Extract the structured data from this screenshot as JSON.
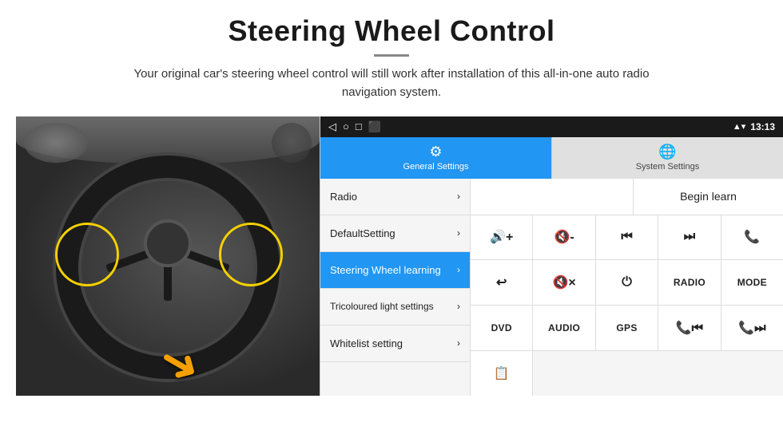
{
  "page": {
    "title": "Steering Wheel Control",
    "divider": "—",
    "subtitle": "Your original car's steering wheel control will still work after installation of this all-in-one auto radio navigation system."
  },
  "status_bar": {
    "time": "13:13",
    "back_icon": "◁",
    "home_icon": "○",
    "recent_icon": "□",
    "screenshot_icon": "⬛",
    "signal_icon": "▲",
    "wifi_icon": "▾"
  },
  "tabs": [
    {
      "id": "general",
      "label": "General Settings",
      "icon": "⚙",
      "active": true
    },
    {
      "id": "system",
      "label": "System Settings",
      "icon": "🌐",
      "active": false
    }
  ],
  "menu_items": [
    {
      "id": "radio",
      "label": "Radio",
      "active": false
    },
    {
      "id": "default",
      "label": "DefaultSetting",
      "active": false
    },
    {
      "id": "steering",
      "label": "Steering Wheel learning",
      "active": true
    },
    {
      "id": "tricoloured",
      "label": "Tricoloured light settings",
      "active": false
    },
    {
      "id": "whitelist",
      "label": "Whitelist setting",
      "active": false
    }
  ],
  "controls": {
    "begin_learn_label": "Begin learn",
    "rows": [
      [
        {
          "id": "vol_up",
          "label": "🔊+",
          "type": "icon"
        },
        {
          "id": "vol_down",
          "label": "🔇-",
          "type": "icon"
        },
        {
          "id": "prev_track",
          "label": "⏮",
          "type": "icon"
        },
        {
          "id": "next_track",
          "label": "⏭",
          "type": "icon"
        },
        {
          "id": "phone",
          "label": "📞",
          "type": "icon"
        }
      ],
      [
        {
          "id": "back_call",
          "label": "↩",
          "type": "icon"
        },
        {
          "id": "mute",
          "label": "🔇×",
          "type": "icon"
        },
        {
          "id": "power",
          "label": "⏻",
          "type": "icon"
        },
        {
          "id": "radio_btn",
          "label": "RADIO",
          "type": "text"
        },
        {
          "id": "mode_btn",
          "label": "MODE",
          "type": "text"
        }
      ],
      [
        {
          "id": "dvd_btn",
          "label": "DVD",
          "type": "text"
        },
        {
          "id": "audio_btn",
          "label": "AUDIO",
          "type": "text"
        },
        {
          "id": "gps_btn",
          "label": "GPS",
          "type": "text"
        },
        {
          "id": "phone_prev",
          "label": "📞⏮",
          "type": "icon"
        },
        {
          "id": "phone_next",
          "label": "📞⏭",
          "type": "icon"
        }
      ],
      [
        {
          "id": "list_btn",
          "label": "≡",
          "type": "icon"
        }
      ]
    ]
  }
}
